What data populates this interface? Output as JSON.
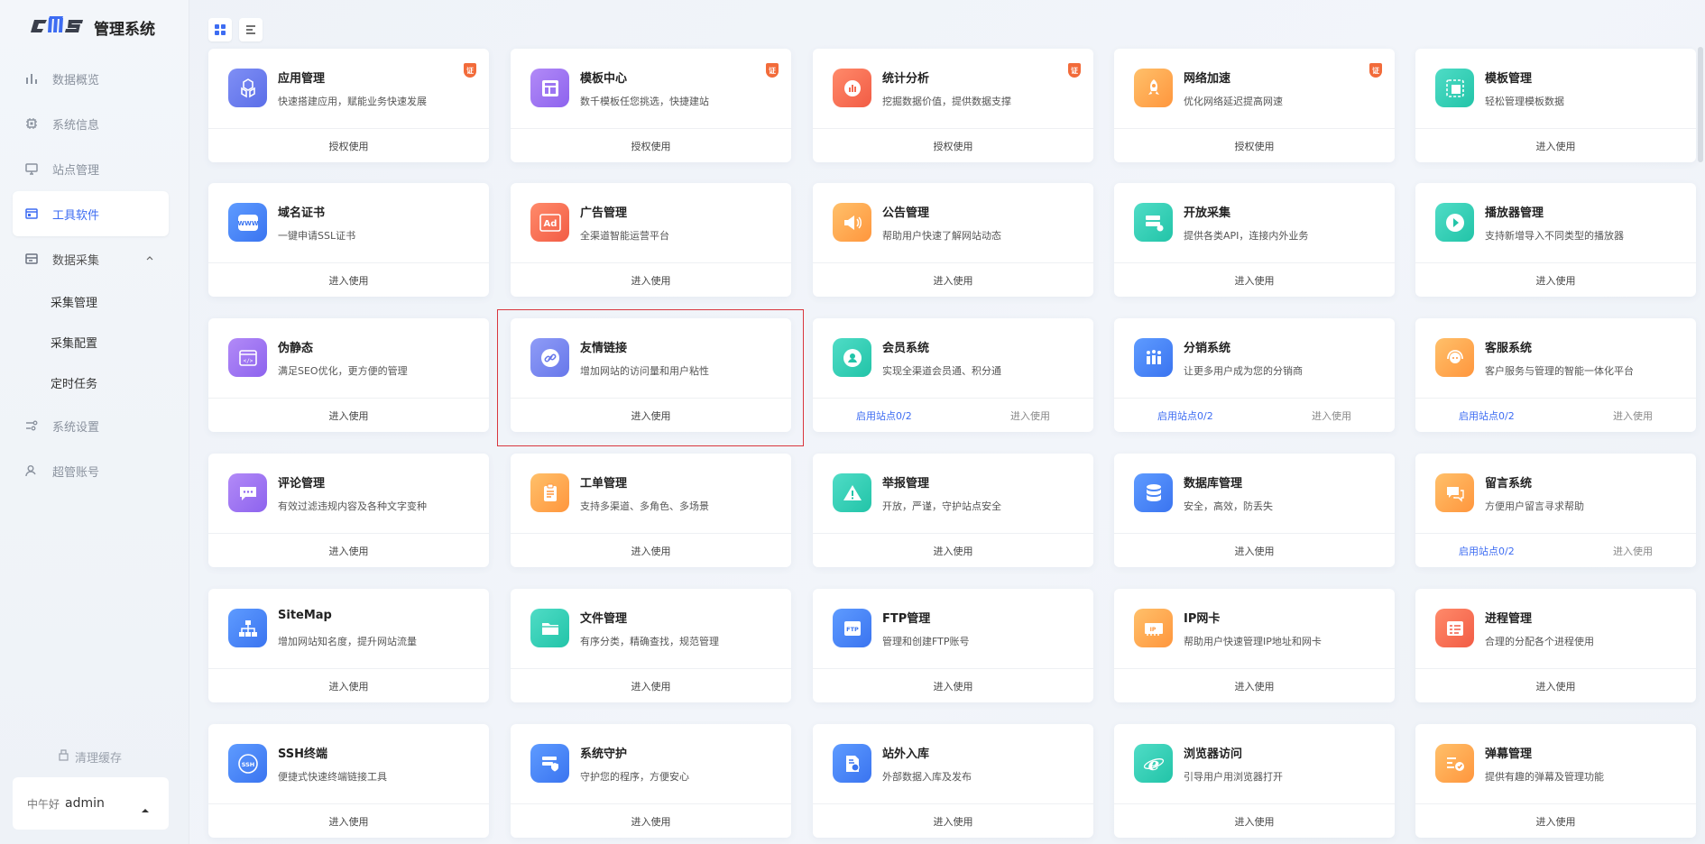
{
  "app": {
    "logo": "cms",
    "title": "管理系统"
  },
  "sidebar": {
    "items": [
      {
        "label": "数据概览",
        "icon": "bar-chart-icon"
      },
      {
        "label": "系统信息",
        "icon": "chip-icon"
      },
      {
        "label": "站点管理",
        "icon": "monitor-icon"
      },
      {
        "label": "工具软件",
        "icon": "window-icon",
        "active": true
      },
      {
        "label": "数据采集",
        "icon": "database-icon",
        "open": true
      }
    ],
    "sub_items": [
      {
        "label": "采集管理"
      },
      {
        "label": "采集配置"
      },
      {
        "label": "定时任务"
      }
    ],
    "bottom_items": [
      {
        "label": "系统设置",
        "icon": "settings-icon"
      },
      {
        "label": "超管账号",
        "icon": "user-icon"
      }
    ],
    "clear_cache": "清理缓存",
    "greeting": "中午好",
    "username": "admin"
  },
  "badge_text": "证",
  "cards": [
    {
      "title": "应用管理",
      "desc": "快速搭建应用，赋能业务快速发展",
      "footer": "授权使用",
      "badge": true,
      "icon": "cubes-icon",
      "color1": "#7f8ff5",
      "color2": "#5b6ee8"
    },
    {
      "title": "模板中心",
      "desc": "数千模板任您挑选，快捷建站",
      "footer": "授权使用",
      "badge": true,
      "icon": "layout-icon",
      "color1": "#b28af7",
      "color2": "#8d63ee"
    },
    {
      "title": "统计分析",
      "desc": "挖掘数据价值，提供数据支撑",
      "footer": "授权使用",
      "badge": true,
      "icon": "stats-icon",
      "color1": "#ff8a6a",
      "color2": "#f25c45"
    },
    {
      "title": "网络加速",
      "desc": "优化网络延迟提高网速",
      "footer": "授权使用",
      "badge": true,
      "icon": "rocket-icon",
      "color1": "#ffc06a",
      "color2": "#ff963d"
    },
    {
      "title": "模板管理",
      "desc": "轻松管理模板数据",
      "footer": "进入使用",
      "badge": false,
      "icon": "template-icon",
      "color1": "#4fdcc6",
      "color2": "#22c4a8"
    },
    {
      "title": "域名证书",
      "desc": "一键申请SSL证书",
      "footer": "进入使用",
      "icon": "www-icon",
      "color1": "#5e9bff",
      "color2": "#3a74f0"
    },
    {
      "title": "广告管理",
      "desc": "全渠道智能运营平台",
      "footer": "进入使用",
      "icon": "ad-icon",
      "color1": "#ff8a6a",
      "color2": "#f25c45"
    },
    {
      "title": "公告管理",
      "desc": "帮助用户快速了解网站动态",
      "footer": "进入使用",
      "icon": "megaphone-icon",
      "color1": "#ffc06a",
      "color2": "#ff963d"
    },
    {
      "title": "开放采集",
      "desc": "提供各类API，连接内外业务",
      "footer": "进入使用",
      "icon": "server-icon",
      "color1": "#4fdcc6",
      "color2": "#22c4a8"
    },
    {
      "title": "播放器管理",
      "desc": "支持新增导入不同类型的播放器",
      "footer": "进入使用",
      "icon": "play-icon",
      "color1": "#4fdcc6",
      "color2": "#22c4a8"
    },
    {
      "title": "伪静态",
      "desc": "满足SEO优化，更方便的管理",
      "footer": "进入使用",
      "icon": "code-window-icon",
      "color1": "#b28af7",
      "color2": "#8d63ee"
    },
    {
      "title": "友情链接",
      "desc": "增加网站的访问量和用户粘性",
      "footer": "进入使用",
      "icon": "link-icon",
      "color1": "#8f9cf7",
      "color2": "#6777ea"
    },
    {
      "title": "会员系统",
      "desc": "实现全渠道会员通、积分通",
      "footer_left": "启用站点0/2",
      "footer_right": "进入使用",
      "icon": "member-icon",
      "color1": "#4fdcc6",
      "color2": "#22c4a8"
    },
    {
      "title": "分销系统",
      "desc": "让更多用户成为您的分销商",
      "footer_left": "启用站点0/2",
      "footer_right": "进入使用",
      "icon": "team-icon",
      "color1": "#5e9bff",
      "color2": "#3a74f0"
    },
    {
      "title": "客服系统",
      "desc": "客户服务与管理的智能一体化平台",
      "footer_left": "启用站点0/2",
      "footer_right": "进入使用",
      "icon": "headset-icon",
      "color1": "#ffc06a",
      "color2": "#ff963d"
    },
    {
      "title": "评论管理",
      "desc": "有效过滤违规内容及各种文字变种",
      "footer": "进入使用",
      "icon": "comment-icon",
      "color1": "#b28af7",
      "color2": "#8d63ee"
    },
    {
      "title": "工单管理",
      "desc": "支持多渠道、多角色、多场景",
      "footer": "进入使用",
      "icon": "clipboard-icon",
      "color1": "#ffc06a",
      "color2": "#ff963d"
    },
    {
      "title": "举报管理",
      "desc": "开放，严谨，守护站点安全",
      "footer": "进入使用",
      "icon": "warning-icon",
      "color1": "#4fdcc6",
      "color2": "#22c4a8"
    },
    {
      "title": "数据库管理",
      "desc": "安全，高效，防丢失",
      "footer": "进入使用",
      "icon": "db-icon",
      "color1": "#5e9bff",
      "color2": "#3a74f0"
    },
    {
      "title": "留言系统",
      "desc": "方便用户留言寻求帮助",
      "footer_left": "启用站点0/2",
      "footer_right": "进入使用",
      "icon": "chat-icon",
      "color1": "#ffc06a",
      "color2": "#ff963d"
    },
    {
      "title": "SiteMap",
      "desc": "增加网站知名度，提升网站流量",
      "footer": "进入使用",
      "icon": "sitemap-icon",
      "color1": "#5e9bff",
      "color2": "#3a74f0"
    },
    {
      "title": "文件管理",
      "desc": "有序分类，精确查找，规范管理",
      "footer": "进入使用",
      "icon": "folder-icon",
      "color1": "#4fdcc6",
      "color2": "#22c4a8"
    },
    {
      "title": "FTP管理",
      "desc": "管理和创建FTP账号",
      "footer": "进入使用",
      "icon": "ftp-icon",
      "color1": "#5e9bff",
      "color2": "#3a74f0"
    },
    {
      "title": "IP网卡",
      "desc": "帮助用户快速管理IP地址和网卡",
      "footer": "进入使用",
      "icon": "nic-icon",
      "color1": "#ffc06a",
      "color2": "#ff963d"
    },
    {
      "title": "进程管理",
      "desc": "合理的分配各个进程使用",
      "footer": "进入使用",
      "icon": "process-icon",
      "color1": "#ff8a6a",
      "color2": "#f25c45"
    },
    {
      "title": "SSH终端",
      "desc": "便捷式快速终端链接工具",
      "footer": "进入使用",
      "icon": "ssh-icon",
      "color1": "#5e9bff",
      "color2": "#3a74f0"
    },
    {
      "title": "系统守护",
      "desc": "守护您的程序，方便安心",
      "footer": "进入使用",
      "icon": "shield-server-icon",
      "color1": "#5e9bff",
      "color2": "#3a74f0"
    },
    {
      "title": "站外入库",
      "desc": "外部数据入库及发布",
      "footer": "进入使用",
      "icon": "doc-import-icon",
      "color1": "#5e9bff",
      "color2": "#3a74f0"
    },
    {
      "title": "浏览器访问",
      "desc": "引导用户用浏览器打开",
      "footer": "进入使用",
      "icon": "browser-icon",
      "color1": "#4fdcc6",
      "color2": "#22c4a8"
    },
    {
      "title": "弹幕管理",
      "desc": "提供有趣的弹幕及管理功能",
      "footer": "进入使用",
      "icon": "danmaku-icon",
      "color1": "#ffc06a",
      "color2": "#ff963d"
    }
  ]
}
